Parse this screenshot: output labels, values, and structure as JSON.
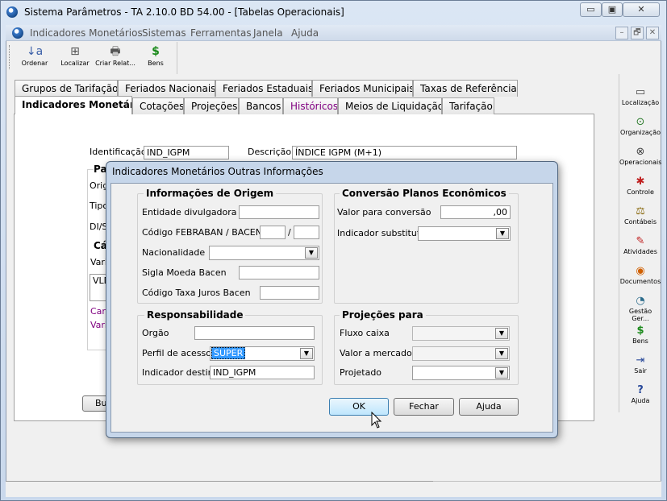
{
  "window": {
    "title": "Sistema Parâmetros -  TA 2.10.0 BD 54.00 - [Tabelas Operacionais]",
    "minimize": "▭",
    "restore": "▣",
    "close": "✕"
  },
  "menu": {
    "items": [
      "Indicadores Monetários",
      "Sistemas",
      "Ferramentas",
      "Janela",
      "Ajuda"
    ],
    "mdi_buttons": [
      "–",
      "🗗",
      "✕"
    ]
  },
  "toolbar": {
    "buttons": [
      {
        "label": "Ordenar",
        "icon": "sort-az-icon",
        "glyph": "↓a"
      },
      {
        "label": "Localizar",
        "icon": "find-icon",
        "glyph": "⊞"
      },
      {
        "label": "Criar Relat...",
        "icon": "report-icon",
        "glyph": "🖶"
      },
      {
        "label": "Bens",
        "icon": "money-bag-icon",
        "glyph": "$"
      }
    ]
  },
  "rightbar": {
    "items": [
      {
        "label": "Localização",
        "icon": "location-icon",
        "glyph": "▭"
      },
      {
        "label": "Organização",
        "icon": "organization-icon",
        "glyph": "⊙"
      },
      {
        "label": "Operacionais",
        "icon": "operational-icon",
        "glyph": "⊗"
      },
      {
        "label": "Controle",
        "icon": "control-icon",
        "glyph": "✱"
      },
      {
        "label": "Contábeis",
        "icon": "accounting-icon",
        "glyph": "⚖"
      },
      {
        "label": "Atividades",
        "icon": "activities-icon",
        "glyph": "✎"
      },
      {
        "label": "Documentos",
        "icon": "documents-icon",
        "glyph": "◉"
      },
      {
        "label": "Gestão Ger...",
        "icon": "management-icon",
        "glyph": "◔"
      },
      {
        "label": "Bens",
        "icon": "money-bag-icon",
        "glyph": "$"
      },
      {
        "label": "Sair",
        "icon": "exit-icon",
        "glyph": "⇥"
      },
      {
        "label": "Ajuda",
        "icon": "help-icon",
        "glyph": "?"
      }
    ]
  },
  "tabs": {
    "row1": [
      "Grupos de Tarifação",
      "Feriados Nacionais",
      "Feriados Estaduais",
      "Feriados Municipais",
      "Taxas de Referência"
    ],
    "row2": [
      "Indicadores Monetários",
      "Cotações",
      "Projeções",
      "Bancos",
      "Históricos",
      "Meios de Liquidação",
      "Tarifação"
    ]
  },
  "background_form": {
    "identificacao_label": "Identificação",
    "identificacao_value": "IND_IGPM",
    "descricao_label": "Descrição",
    "descricao_value": "ÍNDICE IGPM (M+1)",
    "partial_group1": "Pa",
    "partial_orig": "Orig",
    "partial_tipo": "Tipo",
    "partial_di": "DI/S",
    "partial_group2": "Cá",
    "partial_vari": "Vari",
    "partial_vld": "VLD",
    "partial_car": "Car",
    "partial_vari2": "Vari",
    "partial_button": "Bu"
  },
  "dialog": {
    "title": "Indicadores Monetários Outras Informações",
    "origem": {
      "title": "Informações de Origem",
      "entidade_label": "Entidade divulgadora",
      "entidade_value": "",
      "codigo_label": "Código FEBRABAN / BACEN",
      "codigo_sep": "/",
      "codigo_value1": "",
      "codigo_value2": "",
      "nacionalidade_label": "Nacionalidade",
      "nacionalidade_value": "",
      "sigla_label": "Sigla Moeda Bacen",
      "sigla_value": "",
      "taxa_label": "Código Taxa Juros Bacen",
      "taxa_value": ""
    },
    "conversao": {
      "title": "Conversão Planos Econômicos",
      "valor_label": "Valor para conversão",
      "valor_value": ",00",
      "indicador_label": "Indicador substituto",
      "indicador_value": ""
    },
    "responsabilidade": {
      "title": "Responsabilidade",
      "orgao_label": "Orgão",
      "orgao_value": "",
      "perfil_label": "Perfil de acesso",
      "perfil_value": "SUPER",
      "destino_label": "Indicador destino",
      "destino_value": "IND_IGPM"
    },
    "projecoes": {
      "title": "Projeções para",
      "fluxo_label": "Fluxo caixa",
      "mercado_label": "Valor a mercado",
      "projetado_label": "Projetado"
    },
    "buttons": {
      "ok": "OK",
      "fechar": "Fechar",
      "ajuda": "Ajuda"
    }
  },
  "colors": {
    "selection": "#3399ff",
    "visited_link": "#800080",
    "dialog_frame": "#c6d6ea"
  }
}
